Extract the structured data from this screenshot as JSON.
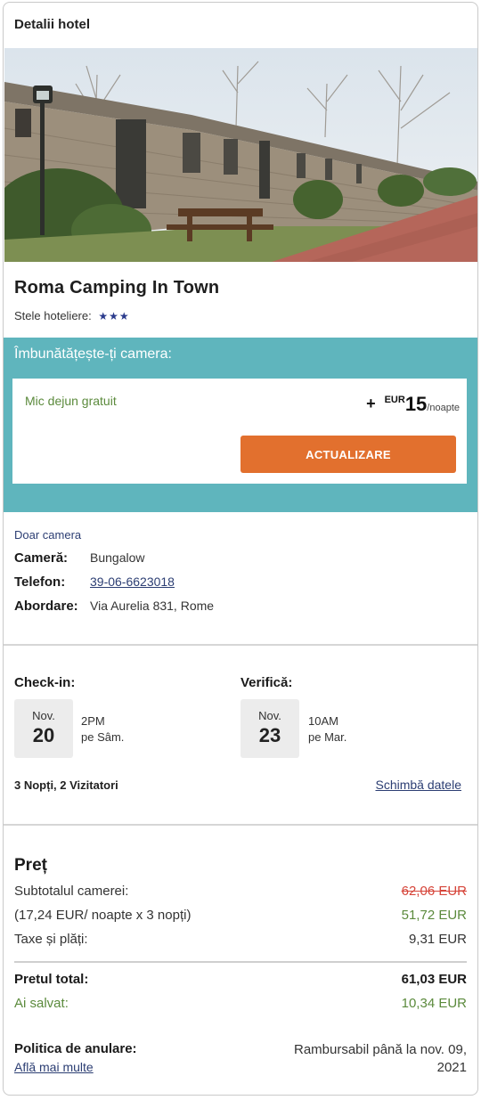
{
  "header": {
    "title": "Detalii hotel"
  },
  "hotel": {
    "name": "Roma Camping In Town",
    "stars_label": "Stele hoteliere:",
    "stars": "★★★"
  },
  "upgrade": {
    "title": "Îmbunătățește-ți camera:",
    "offer": "Mic dejun gratuit",
    "plus": "+",
    "currency": "EUR",
    "amount": "15",
    "per": "/noapte",
    "button": "ACTUALIZARE"
  },
  "room": {
    "type": "Doar camera",
    "camera_label": "Cameră:",
    "camera_value": "Bungalow",
    "phone_label": "Telefon:",
    "phone_value": "39-06-6623018",
    "address_label": "Abordare:",
    "address_value": "Via Aurelia 831, Rome"
  },
  "stay": {
    "checkin_label": "Check-in:",
    "checkin_month": "Nov.",
    "checkin_day": "20",
    "checkin_time": "2PM",
    "checkin_weekday": "pe Sâm.",
    "checkout_label": "Verifică:",
    "checkout_month": "Nov.",
    "checkout_day": "23",
    "checkout_time": "10AM",
    "checkout_weekday": "pe Mar.",
    "summary": "3 Nopți, 2 Vizitatori",
    "change_link": "Schimbă datele"
  },
  "price": {
    "title": "Preț",
    "subtotal_label": "Subtotalul camerei:",
    "subtotal_original": "62,06 EUR",
    "nightly_label": "(17,24 EUR/ noapte x 3 nopți)",
    "nightly_value": "51,72 EUR",
    "taxes_label": "Taxe și plăți:",
    "taxes_value": "9,31 EUR",
    "total_label": "Pretul total:",
    "total_value": "61,03 EUR",
    "saved_label": "Ai salvat:",
    "saved_value": "10,34 EUR"
  },
  "policy": {
    "title": "Politica de anulare:",
    "link": "Află mai multe",
    "value": "Rambursabil până la nov. 09, 2021"
  },
  "colors": {
    "accent_teal": "#5fb5bd",
    "button_orange": "#e2702e",
    "link_blue": "#2c3e73",
    "savings_green": "#5b8a3c",
    "strike_red": "#d6453a"
  }
}
